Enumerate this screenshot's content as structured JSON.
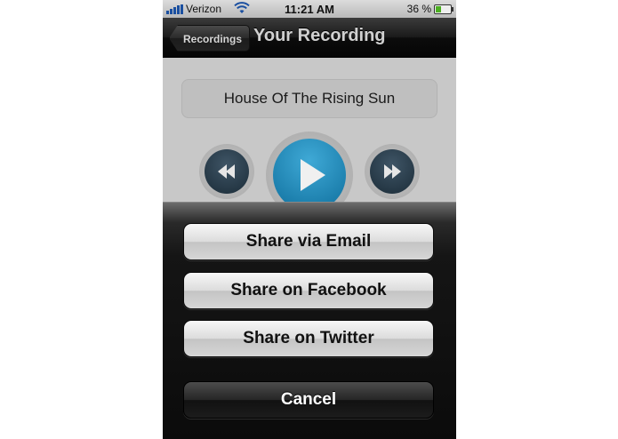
{
  "status_bar": {
    "carrier": "Verizon",
    "time": "11:21 AM",
    "battery_percent": "36 %",
    "battery_level": 0.36,
    "icons": [
      "signal-bars-icon",
      "wifi-icon",
      "battery-icon"
    ]
  },
  "nav_bar": {
    "back_label": "Recordings",
    "title": "Your Recording"
  },
  "player": {
    "song_title": "House Of The Rising Sun",
    "controls": [
      "rewind-icon",
      "play-icon",
      "fast-forward-icon"
    ],
    "accent_color": "#1a8cc2"
  },
  "action_sheet": {
    "email_label": "Share via Email",
    "facebook_label": "Share on Facebook",
    "twitter_label": "Share on Twitter",
    "cancel_label": "Cancel"
  }
}
